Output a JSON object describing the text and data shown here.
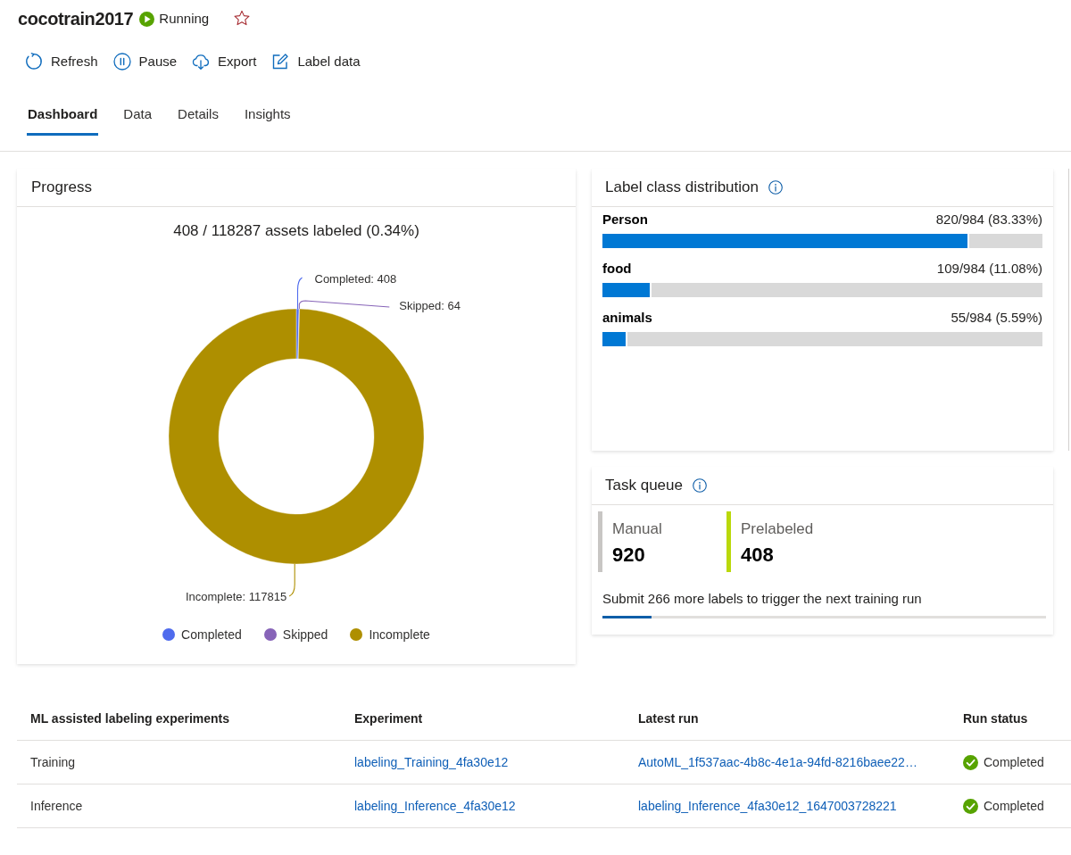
{
  "header": {
    "title": "cocotrain2017",
    "status": {
      "label": "Running",
      "kind": "running"
    },
    "favorite": false
  },
  "toolbar": [
    {
      "label": "Refresh"
    },
    {
      "label": "Pause"
    },
    {
      "label": "Export"
    },
    {
      "label": "Label data"
    }
  ],
  "tabs": [
    {
      "label": "Dashboard",
      "selected": true
    },
    {
      "label": "Data",
      "selected": false
    },
    {
      "label": "Details",
      "selected": false
    },
    {
      "label": "Insights",
      "selected": false
    }
  ],
  "progress": {
    "title": "Progress",
    "summary": "408 / 118287 assets labeled (0.34%)",
    "chart_data": {
      "type": "donut",
      "categories": [
        "Completed",
        "Skipped",
        "Incomplete"
      ],
      "values": [
        408,
        64,
        117815
      ],
      "colors": [
        "#4f6bed",
        "#8764b8",
        "#ae8f00"
      ],
      "value_labels": [
        "Completed: 408",
        "Skipped: 64",
        "Incomplete: 117815"
      ],
      "legend": "bottom"
    }
  },
  "label_class_distribution": {
    "title": "Label class distribution",
    "classes": [
      {
        "name": "Person",
        "reading": "820/984 (83.33%)",
        "level": 0.8333
      },
      {
        "name": "food",
        "reading": "109/984 (11.08%)",
        "level": 0.1108
      },
      {
        "name": "animals",
        "reading": "55/984 (5.59%)",
        "level": 0.0559
      }
    ]
  },
  "task_queue": {
    "title": "Task queue",
    "stats": [
      {
        "label": "Manual",
        "value": "920",
        "color": "#c8c6c4"
      },
      {
        "label": "Prelabeled",
        "value": "408",
        "color": "#bad80a"
      }
    ],
    "message": "Submit 266 more labels to trigger the next training run",
    "level": 0.11
  },
  "experiments_table": {
    "columns": [
      "ML assisted labeling experiments",
      "Experiment",
      "Latest run",
      "Run status"
    ],
    "rows": [
      {
        "name": "Training",
        "experiment": "labeling_Training_4fa30e12",
        "latest_run": "AutoML_1f537aac-4b8c-4e1a-94fd-8216baee22…",
        "run_status": {
          "label": "Completed",
          "kind": "success"
        }
      },
      {
        "name": "Inference",
        "experiment": "labeling_Inference_4fa30e12",
        "latest_run": "labeling_Inference_4fa30e12_1647003728221",
        "run_status": {
          "label": "Completed",
          "kind": "success"
        }
      }
    ]
  }
}
